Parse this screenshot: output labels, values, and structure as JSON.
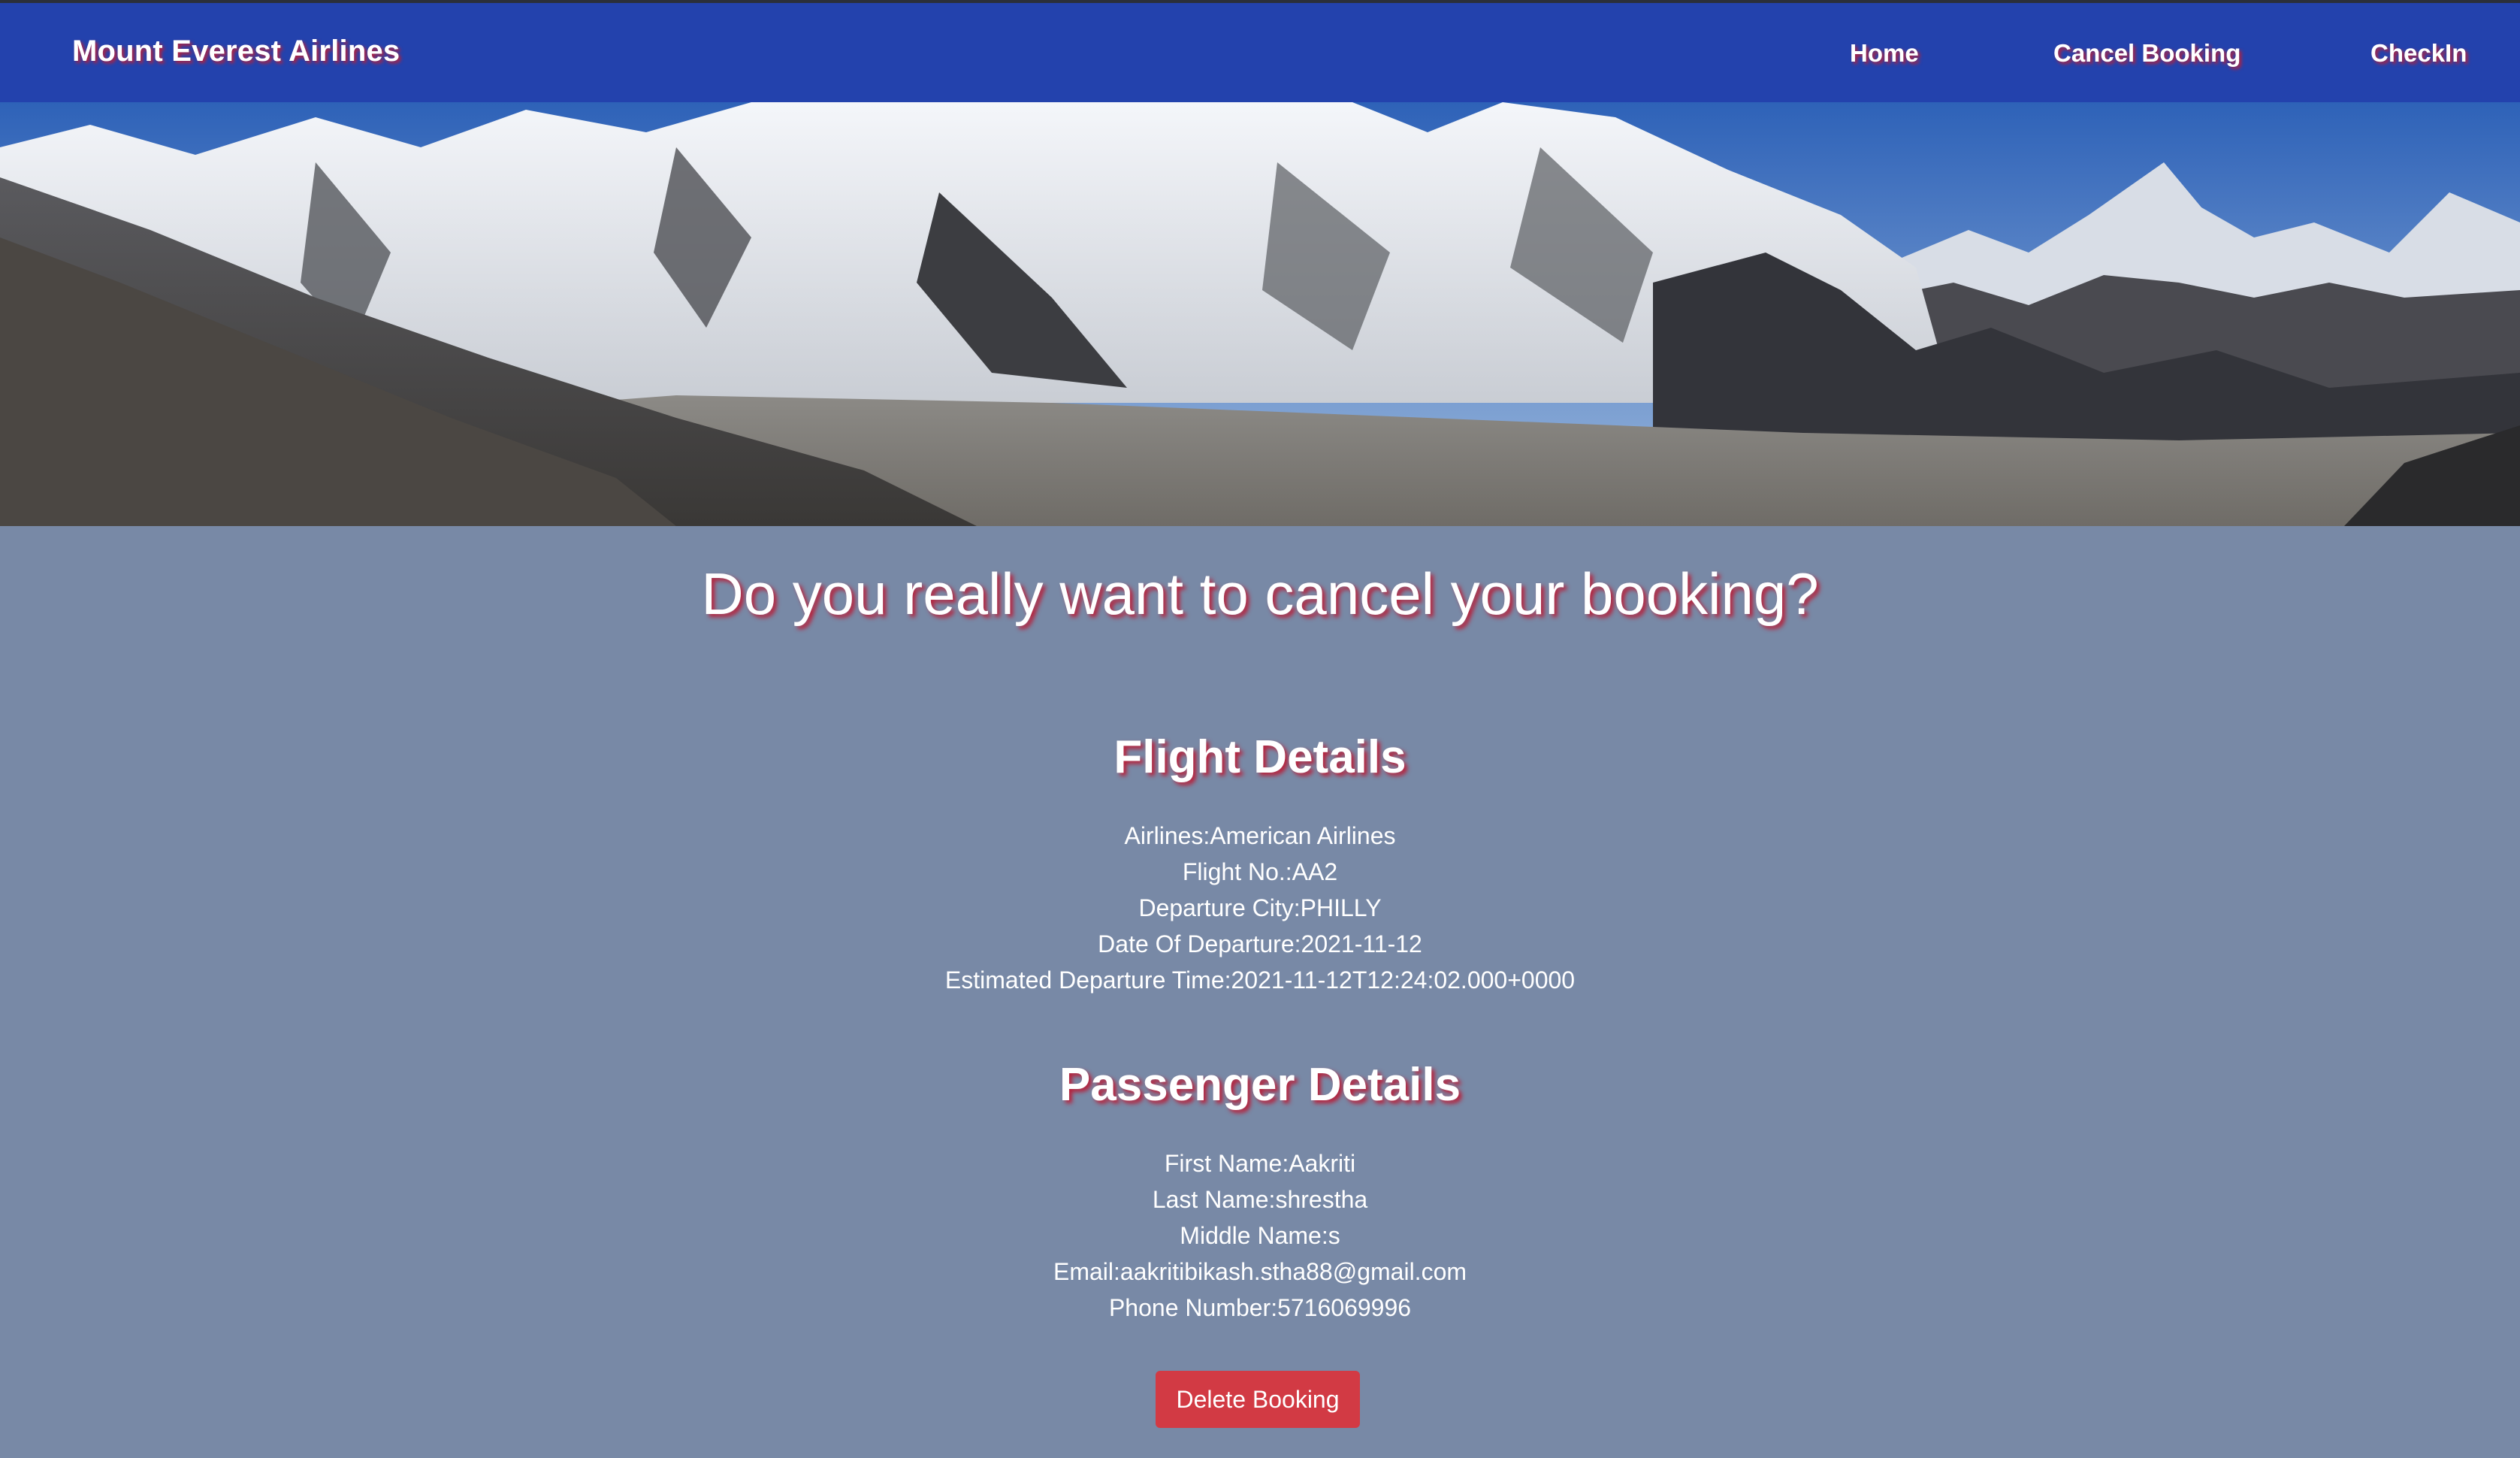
{
  "navbar": {
    "brand": "Mount Everest Airlines",
    "links": [
      {
        "label": "Home"
      },
      {
        "label": "Cancel Booking"
      },
      {
        "label": "CheckIn"
      }
    ],
    "bg_color": "#2342ad"
  },
  "hero": {
    "alt": "Mount Everest panorama"
  },
  "main": {
    "headline": "Do you really want to cancel your booking?",
    "flight_details": {
      "title": "Flight Details",
      "rows": [
        "Airlines:American Airlines",
        "Flight No.:AA2",
        "Departure City:PHILLY",
        "Date Of Departure:2021-11-12",
        "Estimated Departure Time:2021-11-12T12:24:02.000+0000"
      ]
    },
    "passenger_details": {
      "title": "Passenger Details",
      "rows": [
        "First Name:Aakriti",
        "Last Name:shrestha",
        "Middle Name:s",
        "Email:aakritibikash.stha88@gmail.com",
        "Phone Number:5716069996"
      ]
    },
    "delete_button": "Delete Booking"
  },
  "colors": {
    "background": "#7889a6",
    "text_shadow": "#b8203a",
    "button": "#d23a44"
  }
}
